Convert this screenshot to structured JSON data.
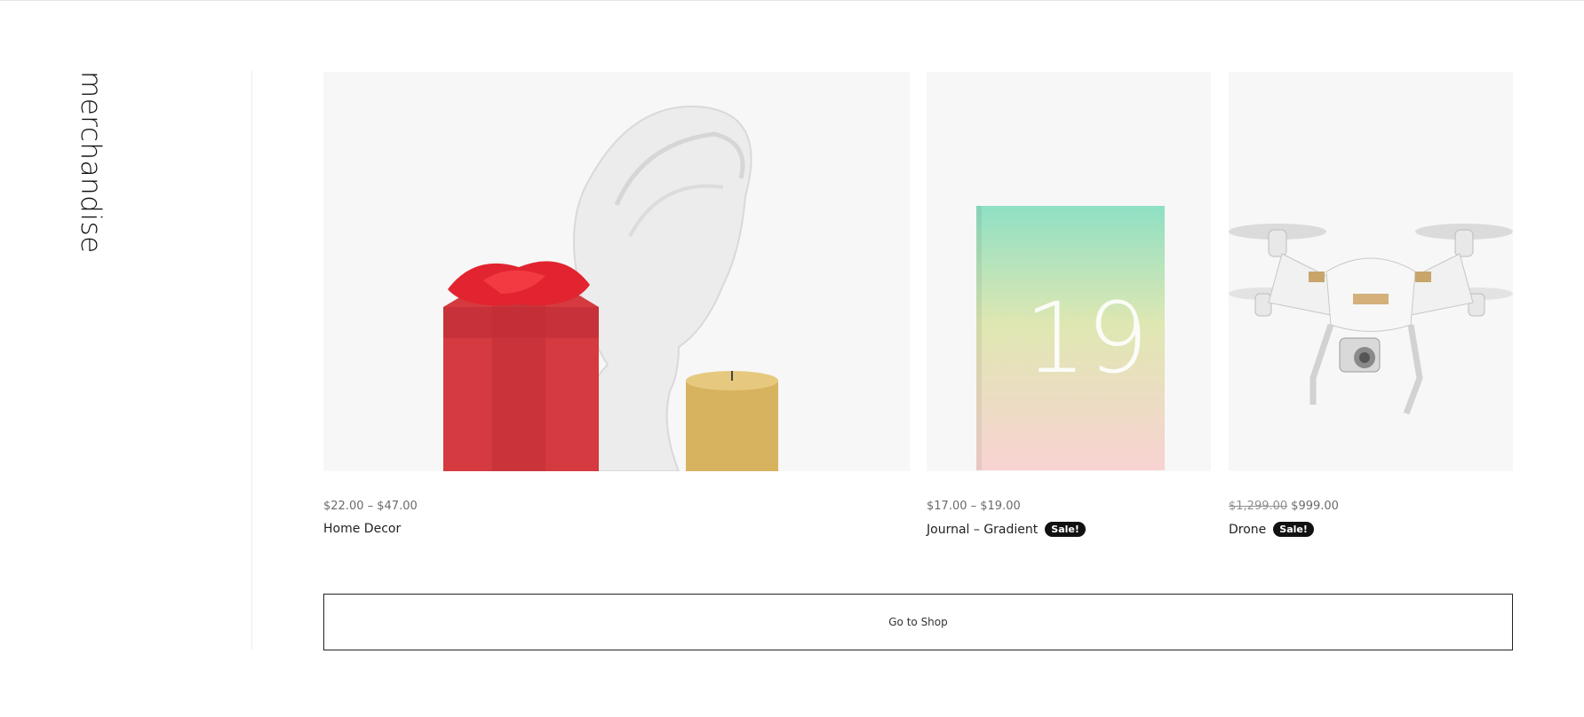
{
  "section": {
    "title": "merchandise"
  },
  "products": [
    {
      "price": "$22.00 – $47.00",
      "name": "Home Decor"
    },
    {
      "price": "$17.00 – $19.00",
      "name": "Journal – Gradient",
      "badge": "Sale!"
    },
    {
      "price_old": "$1,299.00",
      "price": "$999.00",
      "name": "Drone",
      "badge": "Sale!"
    }
  ],
  "journal_cover_number": "19",
  "cta": {
    "label": "Go to Shop"
  }
}
